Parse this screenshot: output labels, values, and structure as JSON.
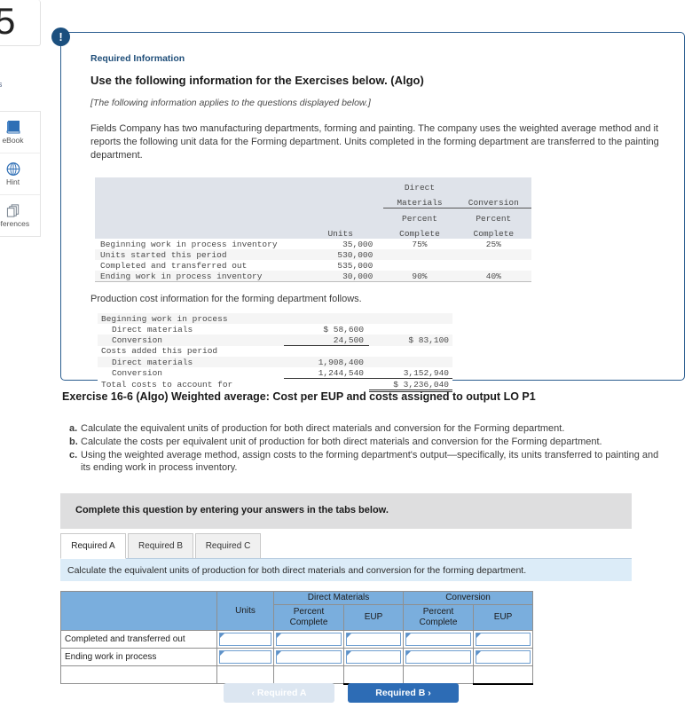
{
  "sidebar": {
    "question_number": "5",
    "points_label": "nts",
    "tools": [
      {
        "label": "eBook",
        "icon": "book-icon"
      },
      {
        "label": "Hint",
        "icon": "globe-icon"
      },
      {
        "label": "eferences",
        "icon": "references-icon"
      }
    ]
  },
  "required_info": {
    "badge": "!",
    "kicker": "Required Information",
    "title": "Use the following information for the Exercises below. (Algo)",
    "note": "[The following information applies to the questions displayed below.]",
    "paragraph": "Fields Company has two manufacturing departments, forming and painting. The company uses the weighted average method and it reports the following unit data for the Forming department. Units completed in the forming department are transferred to the painting department.",
    "paragraph2": "Production cost information for the forming department follows."
  },
  "units_table": {
    "group_headers": {
      "direct_materials": "Direct\nMaterials",
      "conversion": "Conversion"
    },
    "dm_line1": "Direct",
    "dm_line2": "Materials",
    "conversion_header": "Conversion",
    "units_header": "Units",
    "pct_line1": "Percent",
    "pct_line2": "Complete",
    "rows": [
      {
        "label": "Beginning work in process inventory",
        "units": "35,000",
        "dm_pct": "75%",
        "conv_pct": "25%"
      },
      {
        "label": "Units started this period",
        "units": "530,000",
        "dm_pct": "",
        "conv_pct": ""
      },
      {
        "label": "Completed and transferred out",
        "units": "535,000",
        "dm_pct": "",
        "conv_pct": ""
      },
      {
        "label": "Ending work in process inventory",
        "units": "30,000",
        "dm_pct": "90%",
        "conv_pct": "40%"
      }
    ]
  },
  "cost_table": {
    "rows": [
      {
        "label": "Beginning work in process",
        "indent": false,
        "amount": "",
        "total": ""
      },
      {
        "label": "Direct materials",
        "indent": true,
        "amount": "$ 58,600",
        "total": ""
      },
      {
        "label": "Conversion",
        "indent": true,
        "amount": "24,500",
        "total": "$ 83,100"
      },
      {
        "label": "Costs added this period",
        "indent": false,
        "amount": "",
        "total": ""
      },
      {
        "label": "Direct materials",
        "indent": true,
        "amount": "1,908,400",
        "total": ""
      },
      {
        "label": "Conversion",
        "indent": true,
        "amount": "1,244,540",
        "total": "3,152,940"
      },
      {
        "label": "Total costs to account for",
        "indent": false,
        "amount": "",
        "total": "$ 3,236,040"
      }
    ]
  },
  "exercise": {
    "title": "Exercise 16-6 (Algo) Weighted average: Cost per EUP and costs assigned to output LO P1",
    "requirements": [
      {
        "letter": "a.",
        "text": "Calculate the equivalent units of production for both direct materials and conversion for the Forming department."
      },
      {
        "letter": "b.",
        "text": "Calculate the costs per equivalent unit of production for both direct materials and conversion for the Forming department."
      },
      {
        "letter": "c.",
        "text": "Using the weighted average method, assign costs to the forming department's output—specifically, its units transferred to painting and its ending work in process inventory."
      }
    ]
  },
  "tabs_section": {
    "complete_bar": "Complete this question by entering your answers in the tabs below.",
    "tabs": [
      {
        "label": "Required A",
        "active": true
      },
      {
        "label": "Required B",
        "active": false
      },
      {
        "label": "Required C",
        "active": false
      }
    ],
    "instruction": "Calculate the equivalent units of production for both direct materials and conversion for the forming department."
  },
  "answer_table": {
    "headers": {
      "blank": "",
      "units": "Units",
      "direct_materials": "Direct Materials",
      "conversion": "Conversion",
      "percent_complete_1": "Percent",
      "percent_complete_2": "Complete",
      "eup": "EUP"
    },
    "rows": [
      {
        "label": "Completed and transferred out",
        "units": "",
        "dm_pct": "",
        "dm_eup": "",
        "cv_pct": "",
        "cv_eup": ""
      },
      {
        "label": "Ending work in process",
        "units": "",
        "dm_pct": "",
        "dm_eup": "",
        "cv_pct": "",
        "cv_eup": ""
      }
    ],
    "total_row": {
      "label": "",
      "units": "",
      "dm_pct": "",
      "dm_eup": "",
      "cv_pct": "",
      "cv_eup": ""
    }
  },
  "nav": {
    "prev_label": "Required A",
    "next_label": "Required B",
    "prev_chevron": "‹",
    "next_chevron": "›"
  }
}
